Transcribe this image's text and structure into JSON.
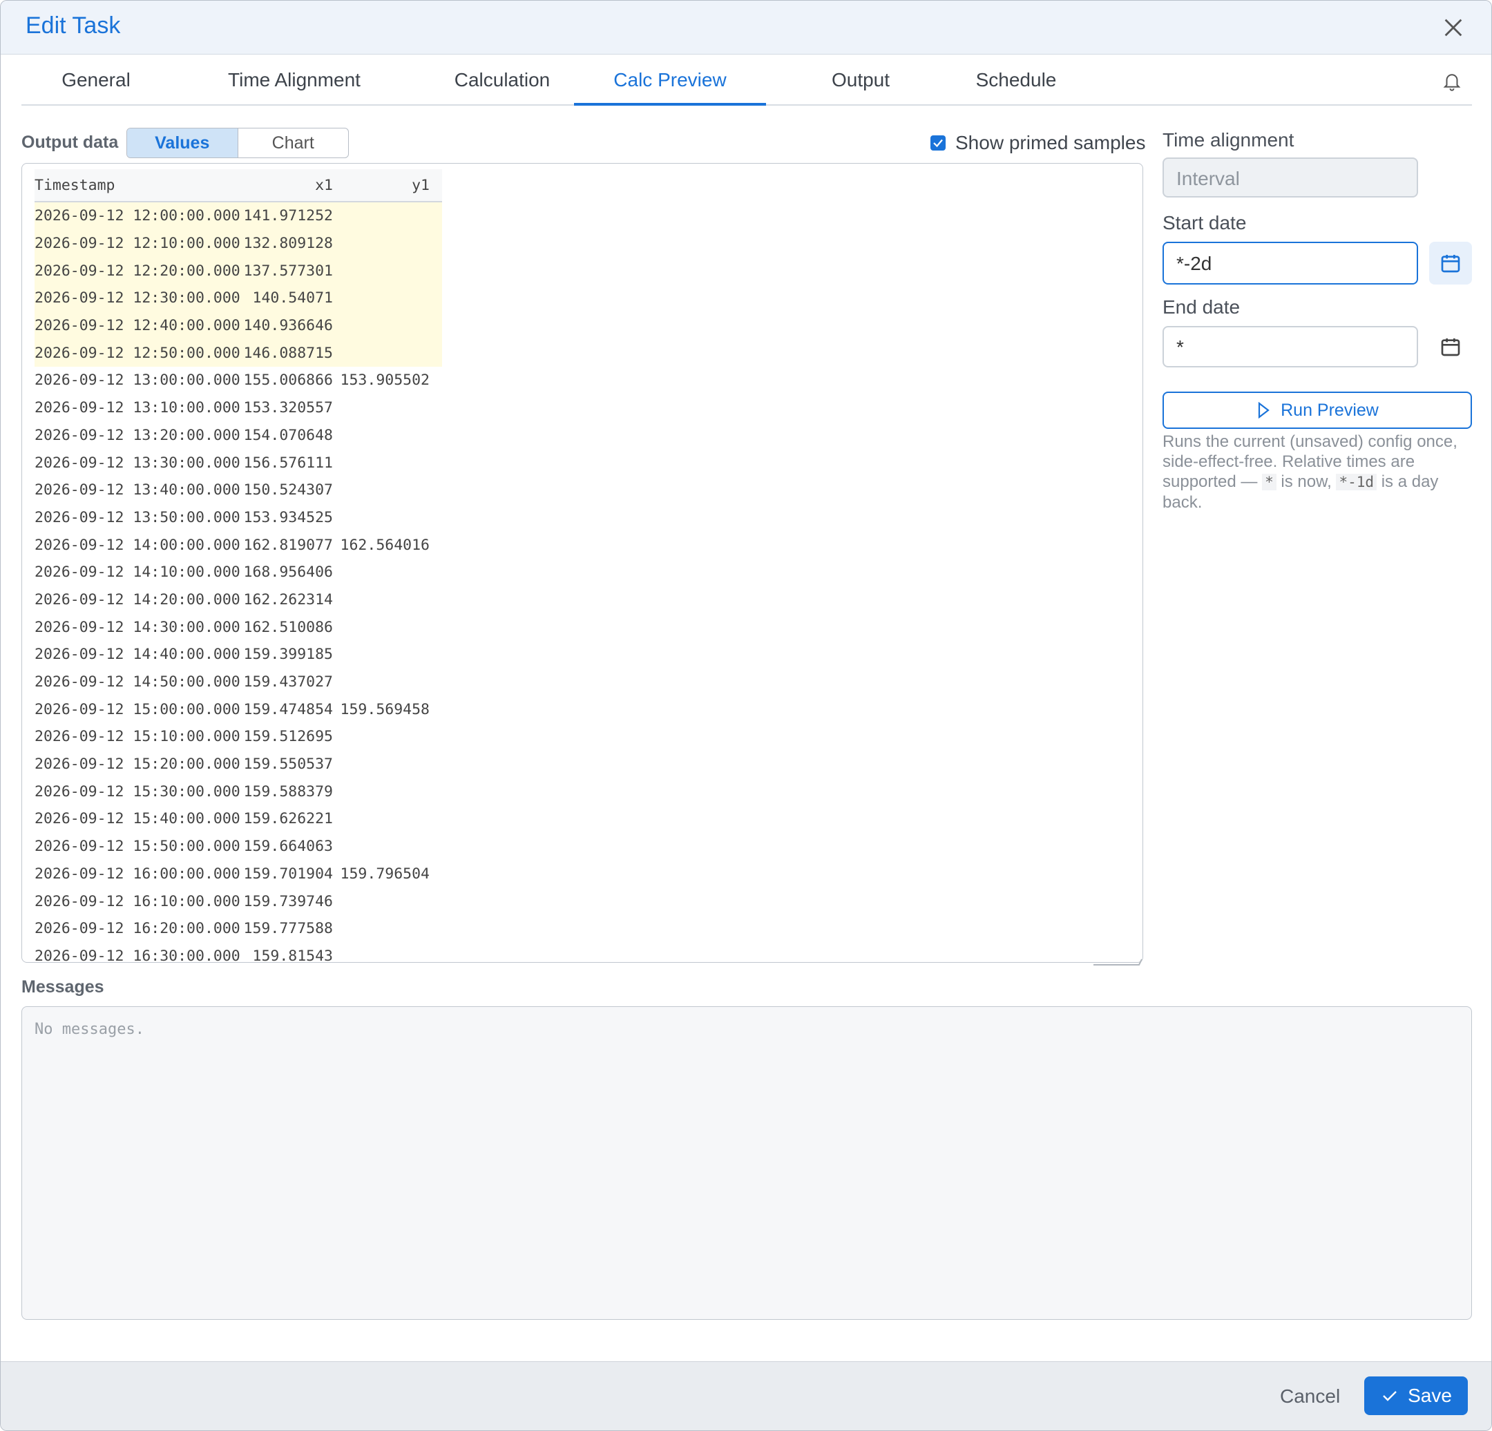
{
  "dialog": {
    "title": "Edit Task"
  },
  "tabs": [
    {
      "label": "General"
    },
    {
      "label": "Time Alignment"
    },
    {
      "label": "Calculation"
    },
    {
      "label": "Calc Preview"
    },
    {
      "label": "Output"
    },
    {
      "label": "Schedule"
    }
  ],
  "active_tab": "Calc Preview",
  "output": {
    "label": "Output data",
    "view_options": [
      "Values",
      "Chart"
    ],
    "selected_view": "Values",
    "show_primed_label": "Show primed samples",
    "show_primed_checked": true
  },
  "table": {
    "headers": [
      "Timestamp",
      "x1",
      "y1"
    ],
    "rows": [
      {
        "ts": "2026-09-12 12:00:00.000",
        "x1": "141.971252",
        "y1": "",
        "primed": true
      },
      {
        "ts": "2026-09-12 12:10:00.000",
        "x1": "132.809128",
        "y1": "",
        "primed": true
      },
      {
        "ts": "2026-09-12 12:20:00.000",
        "x1": "137.577301",
        "y1": "",
        "primed": true
      },
      {
        "ts": "2026-09-12 12:30:00.000",
        "x1": "140.54071",
        "y1": "",
        "primed": true
      },
      {
        "ts": "2026-09-12 12:40:00.000",
        "x1": "140.936646",
        "y1": "",
        "primed": true
      },
      {
        "ts": "2026-09-12 12:50:00.000",
        "x1": "146.088715",
        "y1": "",
        "primed": true
      },
      {
        "ts": "2026-09-12 13:00:00.000",
        "x1": "155.006866",
        "y1": "153.905502",
        "primed": false
      },
      {
        "ts": "2026-09-12 13:10:00.000",
        "x1": "153.320557",
        "y1": "",
        "primed": false
      },
      {
        "ts": "2026-09-12 13:20:00.000",
        "x1": "154.070648",
        "y1": "",
        "primed": false
      },
      {
        "ts": "2026-09-12 13:30:00.000",
        "x1": "156.576111",
        "y1": "",
        "primed": false
      },
      {
        "ts": "2026-09-12 13:40:00.000",
        "x1": "150.524307",
        "y1": "",
        "primed": false
      },
      {
        "ts": "2026-09-12 13:50:00.000",
        "x1": "153.934525",
        "y1": "",
        "primed": false
      },
      {
        "ts": "2026-09-12 14:00:00.000",
        "x1": "162.819077",
        "y1": "162.564016",
        "primed": false
      },
      {
        "ts": "2026-09-12 14:10:00.000",
        "x1": "168.956406",
        "y1": "",
        "primed": false
      },
      {
        "ts": "2026-09-12 14:20:00.000",
        "x1": "162.262314",
        "y1": "",
        "primed": false
      },
      {
        "ts": "2026-09-12 14:30:00.000",
        "x1": "162.510086",
        "y1": "",
        "primed": false
      },
      {
        "ts": "2026-09-12 14:40:00.000",
        "x1": "159.399185",
        "y1": "",
        "primed": false
      },
      {
        "ts": "2026-09-12 14:50:00.000",
        "x1": "159.437027",
        "y1": "",
        "primed": false
      },
      {
        "ts": "2026-09-12 15:00:00.000",
        "x1": "159.474854",
        "y1": "159.569458",
        "primed": false
      },
      {
        "ts": "2026-09-12 15:10:00.000",
        "x1": "159.512695",
        "y1": "",
        "primed": false
      },
      {
        "ts": "2026-09-12 15:20:00.000",
        "x1": "159.550537",
        "y1": "",
        "primed": false
      },
      {
        "ts": "2026-09-12 15:30:00.000",
        "x1": "159.588379",
        "y1": "",
        "primed": false
      },
      {
        "ts": "2026-09-12 15:40:00.000",
        "x1": "159.626221",
        "y1": "",
        "primed": false
      },
      {
        "ts": "2026-09-12 15:50:00.000",
        "x1": "159.664063",
        "y1": "",
        "primed": false
      },
      {
        "ts": "2026-09-12 16:00:00.000",
        "x1": "159.701904",
        "y1": "159.796504",
        "primed": false
      },
      {
        "ts": "2026-09-12 16:10:00.000",
        "x1": "159.739746",
        "y1": "",
        "primed": false
      },
      {
        "ts": "2026-09-12 16:20:00.000",
        "x1": "159.777588",
        "y1": "",
        "primed": false
      },
      {
        "ts": "2026-09-12 16:30:00.000",
        "x1": "159.81543",
        "y1": "",
        "primed": false
      }
    ]
  },
  "side": {
    "time_alignment_label": "Time alignment",
    "time_alignment_placeholder": "Interval",
    "start_label": "Start date",
    "start_value": "*-2d",
    "end_label": "End date",
    "end_value": "*",
    "run_label": "Run Preview",
    "help_1": "Runs the current (unsaved) config once, side-effect-free. Relative times are supported — ",
    "help_code_1": "*",
    "help_2": " is now, ",
    "help_code_2": "*-1d",
    "help_3": " is a day back."
  },
  "messages": {
    "label": "Messages",
    "empty": "No messages."
  },
  "footer": {
    "cancel": "Cancel",
    "save": "Save"
  },
  "colors": {
    "accent": "#1a73d9",
    "primed_row": "#fffbe0"
  }
}
